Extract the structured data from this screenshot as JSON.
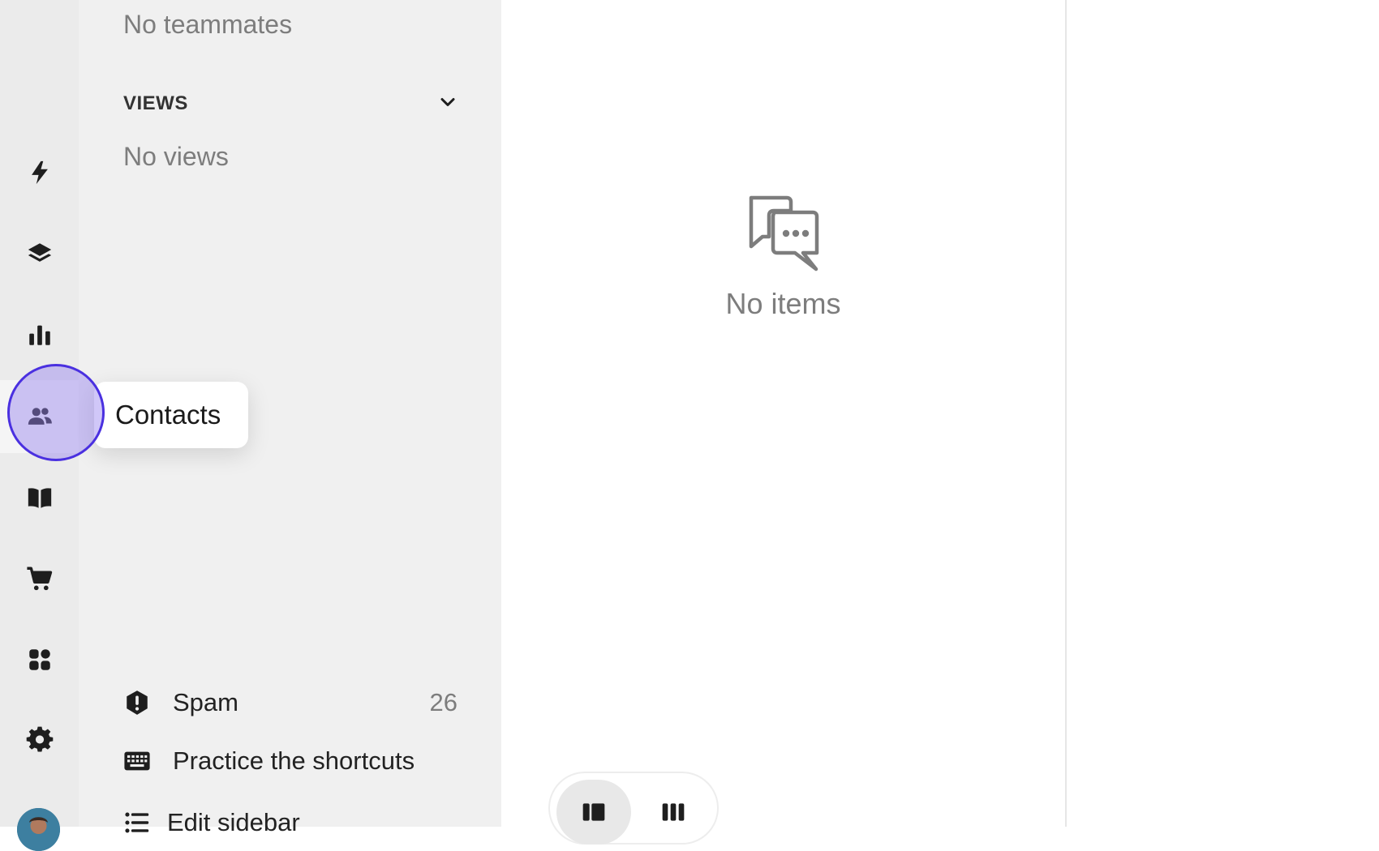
{
  "rail": {
    "items": [
      {
        "icon": "lightning-icon"
      },
      {
        "icon": "layers-icon"
      },
      {
        "icon": "bar-chart-icon"
      },
      {
        "icon": "contacts-icon"
      },
      {
        "icon": "book-icon"
      },
      {
        "icon": "cart-icon"
      },
      {
        "icon": "apps-grid-icon"
      },
      {
        "icon": "gear-icon"
      }
    ],
    "tooltip": "Contacts"
  },
  "sidebar": {
    "no_teammates": "No teammates",
    "views_title": "VIEWS",
    "no_views": "No views",
    "spam_label": "Spam",
    "spam_count": "26",
    "shortcuts_label": "Practice the shortcuts",
    "edit_sidebar_label": "Edit sidebar"
  },
  "main": {
    "empty_text": "No items"
  },
  "colors": {
    "highlight_ring": "#4a30e0",
    "rail_bg": "#ebebeb",
    "sidebar_bg": "#f0f0f0"
  }
}
